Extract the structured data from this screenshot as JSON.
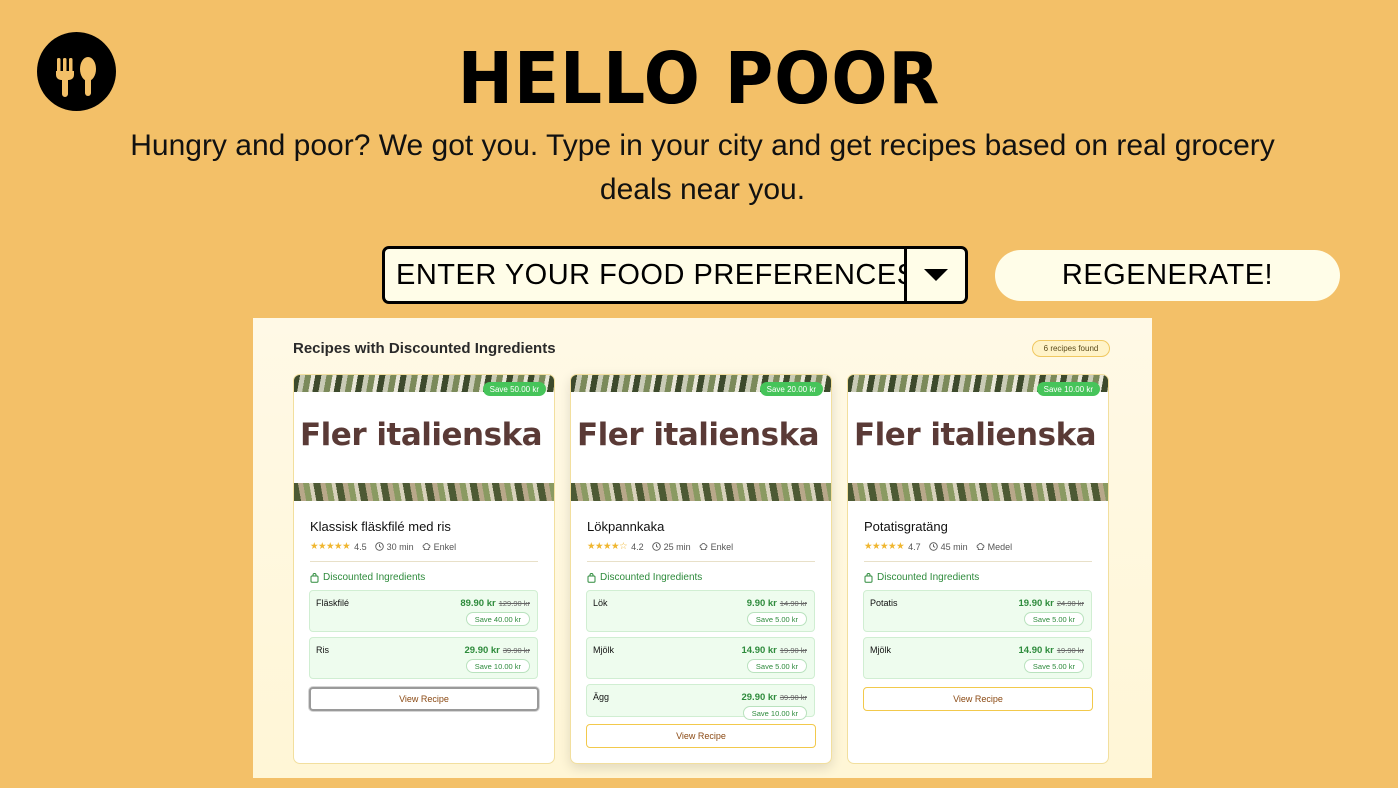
{
  "app": {
    "title": "HELLO POOR",
    "subtitle": "Hungry and poor? We got you. Type in your city and get recipes based on real grocery deals near you."
  },
  "controls": {
    "preferences_value": "ENTER YOUR FOOD PREFERENCES",
    "regenerate_label": "REGENERATE!"
  },
  "panel": {
    "title": "Recipes with Discounted Ingredients",
    "count_badge": "6 recipes found",
    "discounted_heading": "Discounted Ingredients",
    "view_label": "View Recipe",
    "image_text": "Fler italienska recept",
    "recipes": [
      {
        "name": "Klassisk fläskfilé med ris",
        "save": "Save 50.00 kr",
        "stars": "★★★★★",
        "rating": "4.5",
        "time": "30 min",
        "difficulty": "Enkel",
        "ingredients": [
          {
            "name": "Fläskfilé",
            "price": "89.90 kr",
            "old": "129.90 kr",
            "save": "Save 40.00 kr"
          },
          {
            "name": "Ris",
            "price": "29.90 kr",
            "old": "39.90 kr",
            "save": "Save 10.00 kr"
          }
        ]
      },
      {
        "name": "Lökpannkaka",
        "save": "Save 20.00 kr",
        "stars": "★★★★☆",
        "rating": "4.2",
        "time": "25 min",
        "difficulty": "Enkel",
        "ingredients": [
          {
            "name": "Lök",
            "price": "9.90 kr",
            "old": "14.90 kr",
            "save": "Save 5.00 kr"
          },
          {
            "name": "Mjölk",
            "price": "14.90 kr",
            "old": "19.90 kr",
            "save": "Save 5.00 kr"
          },
          {
            "name": "Ägg",
            "price": "29.90 kr",
            "old": "39.90 kr",
            "save": "Save 10.00 kr"
          }
        ]
      },
      {
        "name": "Potatisgratäng",
        "save": "Save 10.00 kr",
        "stars": "★★★★★",
        "rating": "4.7",
        "time": "45 min",
        "difficulty": "Medel",
        "ingredients": [
          {
            "name": "Potatis",
            "price": "19.90 kr",
            "old": "24.90 kr",
            "save": "Save 5.00 kr"
          },
          {
            "name": "Mjölk",
            "price": "14.90 kr",
            "old": "19.90 kr",
            "save": "Save 5.00 kr"
          }
        ]
      }
    ]
  },
  "colors": {
    "background": "#F3C068",
    "cream": "#FFFDE8",
    "green": "#2E8B3C",
    "save_badge": "#46C45A",
    "star": "#F0B62F"
  },
  "icons": [
    "fork-spoon-logo-icon",
    "chevron-down-icon",
    "clock-icon",
    "chef-hat-icon",
    "shopping-bag-icon"
  ]
}
